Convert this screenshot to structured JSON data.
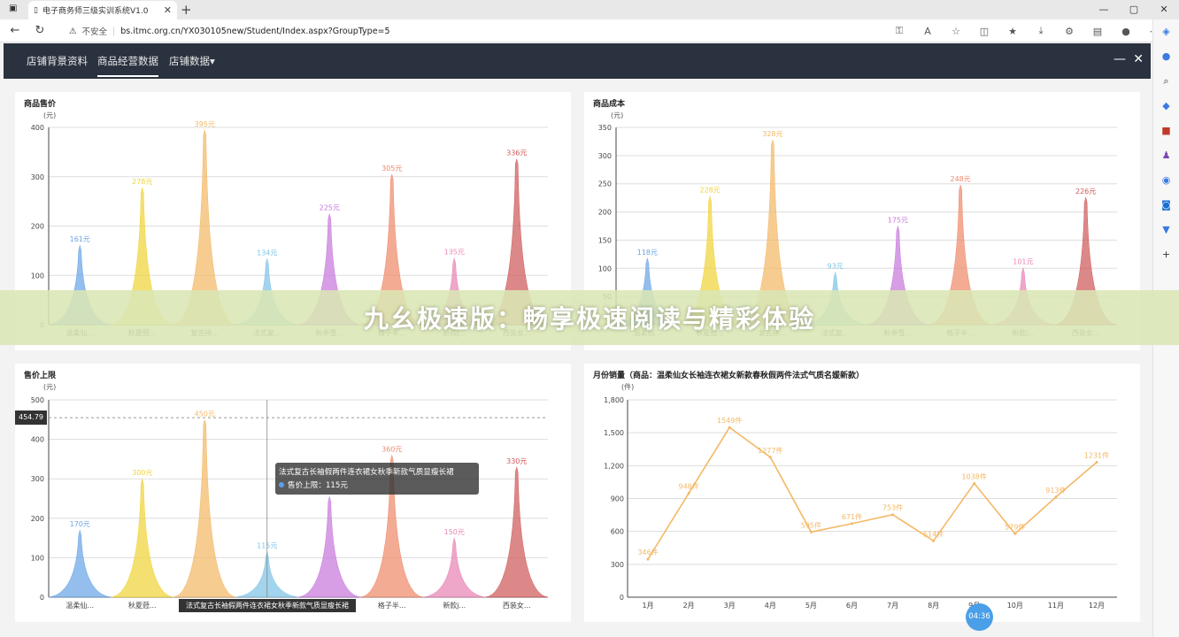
{
  "browser": {
    "tab_title": "电子商务师三级实训系统V1.0",
    "security": "不安全",
    "url": "bs.itmc.org.cn/YX030105new/Student/Index.aspx?GroupType=5"
  },
  "nav": {
    "items": [
      "店铺背景资料",
      "商品经营数据",
      "店铺数据▾"
    ],
    "active_index": 1
  },
  "banner": "九幺极速版：畅享极速阅读与精彩体验",
  "tooltip": {
    "title": "法式复古长袖假两件连衣裙女秋季新款气质显瘦长裙",
    "series": "售价上限：115元"
  },
  "axis_pointer_label": "法式复古长袖假两件连衣裙女秋季新款气质显瘦长裙",
  "y_pointer_label": "454.79",
  "clock": "04:36",
  "chart_data": [
    {
      "type": "bar",
      "title": "商品售价",
      "unit": "(元)",
      "ylim": [
        0,
        400
      ],
      "yticks": [
        0,
        100,
        200,
        300,
        400
      ],
      "categories": [
        "温柔仙...",
        "秋夏蒄...",
        "复古拼...",
        "法式复...",
        "秋季雪...",
        "格子半...",
        "新款j...",
        "西装女..."
      ],
      "values": [
        161,
        278,
        395,
        134,
        225,
        305,
        135,
        336
      ],
      "labels": [
        "161元",
        "278元",
        "395元",
        "134元",
        "225元",
        "305元",
        "135元",
        "336元"
      ]
    },
    {
      "type": "bar",
      "title": "商品成本",
      "unit": "(元)",
      "ylim": [
        0,
        350
      ],
      "yticks": [
        0,
        50,
        100,
        150,
        200,
        250,
        300,
        350
      ],
      "categories": [
        "温柔仙...",
        "秋夏蒄...",
        "复古拼...",
        "法式复...",
        "秋季雪...",
        "格子半...",
        "新款j...",
        "西装女..."
      ],
      "values": [
        118,
        228,
        328,
        93,
        175,
        248,
        101,
        226
      ],
      "labels": [
        "118元",
        "228元",
        "328元",
        "93元",
        "175元",
        "248元",
        "101元",
        "226元"
      ]
    },
    {
      "type": "bar",
      "title": "售价上限",
      "unit": "(元)",
      "ylim": [
        0,
        500
      ],
      "yticks": [
        0,
        100,
        200,
        300,
        400,
        500
      ],
      "categories": [
        "温柔仙...",
        "秋夏蒄...",
        "复古拼...",
        "法式复...",
        "秋季雪...",
        "格子半...",
        "新款j...",
        "西装女..."
      ],
      "values": [
        170,
        300,
        450,
        115,
        255,
        360,
        150,
        330
      ],
      "labels": [
        "170元",
        "300元",
        "450元",
        "115元",
        "",
        "360元",
        "150元",
        "330元"
      ]
    },
    {
      "type": "line",
      "title": "月份销量（商品：温柔仙女长袖连衣裙女新款春秋假两件法式气质名媛新款）",
      "unit": "(件)",
      "ylim": [
        0,
        1800
      ],
      "yticks": [
        "0",
        "300",
        "600",
        "900",
        "1,200",
        "1,500",
        "1,800"
      ],
      "categories": [
        "1月",
        "2月",
        "3月",
        "4月",
        "5月",
        "6月",
        "7月",
        "8月",
        "9月",
        "10月",
        "11月",
        "12月"
      ],
      "values": [
        346,
        948,
        1549,
        1277,
        595,
        671,
        753,
        514,
        1038,
        579,
        913,
        1231
      ],
      "labels": [
        "346件",
        "948件",
        "1549件",
        "1277件",
        "595件",
        "671件",
        "753件",
        "514件",
        "1038件",
        "579件",
        "913件",
        "1231件"
      ]
    }
  ],
  "colors": {
    "peaks": [
      "#6aa5e6",
      "#f0d43a",
      "#f3b866",
      "#7ec4e6",
      "#c779dc",
      "#ef8a6b",
      "#e884b4",
      "#cf5a5a"
    ],
    "line": "#f3b866",
    "navbar": "#2a323f"
  }
}
